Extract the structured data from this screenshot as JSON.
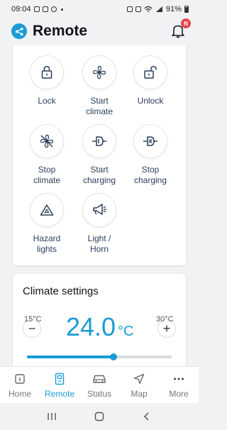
{
  "status_bar": {
    "time": "09:04",
    "battery": "91%"
  },
  "header": {
    "title": "Remote",
    "notification_badge": "N"
  },
  "controls": [
    {
      "label": "Lock",
      "icon": "lock-icon"
    },
    {
      "label": "Start climate",
      "icon": "fan-icon"
    },
    {
      "label": "Unlock",
      "icon": "unlock-icon"
    },
    {
      "label": "Stop climate",
      "icon": "fan-off-icon"
    },
    {
      "label": "Start charging",
      "icon": "plug-icon"
    },
    {
      "label": "Stop charging",
      "icon": "plug-off-icon"
    },
    {
      "label": "Hazard lights",
      "icon": "hazard-icon"
    },
    {
      "label": "Light / Horn",
      "icon": "horn-icon"
    }
  ],
  "climate": {
    "title": "Climate settings",
    "temperature": "24.0",
    "unit": "°C",
    "minus": "−",
    "plus": "+",
    "min_label": "15°C",
    "max_label": "30°C",
    "min_value": 15,
    "max_value": 30,
    "value": 24.0
  },
  "nav": {
    "items": [
      {
        "label": "Home",
        "icon": "home-icon"
      },
      {
        "label": "Remote",
        "icon": "remote-icon",
        "active": true
      },
      {
        "label": "Status",
        "icon": "car-icon"
      },
      {
        "label": "Map",
        "icon": "map-arrow-icon"
      },
      {
        "label": "More",
        "icon": "more-icon"
      }
    ]
  },
  "colors": {
    "accent": "#1a9bd7",
    "badge": "#e2474a",
    "icon": "#2c3e5a"
  }
}
